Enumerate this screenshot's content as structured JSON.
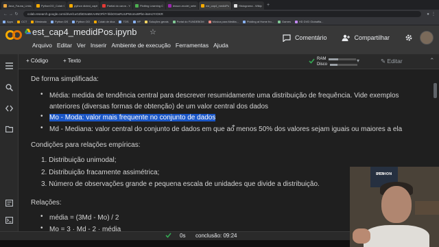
{
  "browser": {
    "tabs": [
      {
        "label": "Java_Fauna_Links_ML-TD..."
      },
      {
        "label": "PythonOO_Colab Ciencia..."
      },
      {
        "label": "python dicted_capit_media..."
      },
      {
        "label": "Partial do carva - YouTube"
      },
      {
        "label": "Plotting Learning Curves"
      },
      {
        "label": "lesson-model_selection_s..."
      },
      {
        "label": "est_cap4_medidPos.ipynb"
      },
      {
        "label": "Histograma - Wikipedia..."
      }
    ],
    "new_tab": "+",
    "url": "colab.research.google.com/drive/1uGZbDSaBKAHNOFkT-hkbOGwRUUPWomo9Pbn-i6eHJYrOKR",
    "bookmarks": [
      {
        "label": "Apps"
      },
      {
        "label": "CCT"
      },
      {
        "label": "Mestrado"
      },
      {
        "label": "Python DS"
      },
      {
        "label": "Python OO"
      },
      {
        "label": "Colab de dica"
      },
      {
        "label": "TOS"
      },
      {
        "label": "HP"
      },
      {
        "label": "Soluções gerais"
      },
      {
        "label": "Portal do FUNDEBOM"
      },
      {
        "label": "Música para Medita..."
      },
      {
        "label": "Pickling at Home fro..."
      },
      {
        "label": "Games"
      },
      {
        "label": "HD DVD Globalfla..."
      }
    ]
  },
  "colab": {
    "notebook_title": "est_cap4_medidPos.ipynb",
    "menu": [
      "Arquivo",
      "Editar",
      "Ver",
      "Inserir",
      "Ambiente de execução",
      "Ferramentas",
      "Ajuda"
    ],
    "comment_label": "Comentário",
    "share_label": "Compartilhar",
    "toolbar": {
      "add_code": "+ Código",
      "add_text": "+ Texto",
      "ram_label": "RAM",
      "disk_label": "Disco",
      "ram_fraction": 0.35,
      "disk_fraction": 0.28,
      "edit_label": "Editar"
    },
    "statusbar": {
      "time": "0s",
      "completion": "conclusão: 09:24"
    }
  },
  "cell": {
    "intro": "De forma simplificada:",
    "items": [
      {
        "bullet": "•",
        "text_1": "Média: medida de tendência central para descrever resumidamente uma distribuição de frequência. Vide exemplos",
        "text_2": "anteriores (diversas formas de obtenção) de um valor central dos dados"
      },
      {
        "bullet": "•",
        "text": "Mo - Moda: valor mais frequente no conjunto de dados"
      },
      {
        "bullet": "•",
        "text": "Md - Mediana: valor central do conjunto de dados em que ao menos 50% dos valores sejam iguais ou maiores a ela"
      }
    ],
    "conditions_title": "Condições para relações empíricas:",
    "conditions": [
      "1. Distribuição unimodal;",
      "2. Distribuição fracamente assimétrica;",
      "3. Número de observações grande e pequena escala de unidades que divide a distribuição."
    ],
    "relations_title": "Relações:",
    "relations": [
      {
        "bullet": "•",
        "text": "média = (3Md - Mo) / 2"
      },
      {
        "bullet": "•",
        "text": "Mo = 3 · Md - 2 · média"
      }
    ]
  },
  "webcam": {
    "poster_line1": "PYTHON",
    "poster_line2": "DSA"
  },
  "colors": {
    "highlight": "#1a56c6",
    "logo_orange": "#f9ab00",
    "logo_yellow": "#e37400",
    "ok_green": "#34a853"
  }
}
